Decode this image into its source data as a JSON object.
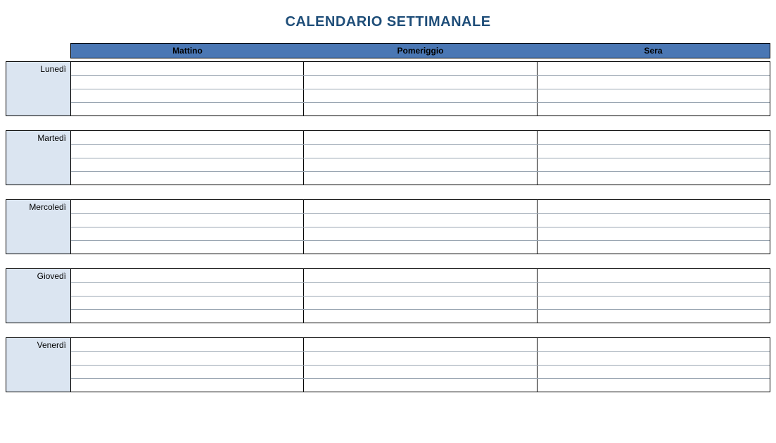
{
  "title": "CALENDARIO SETTIMANALE",
  "columns": [
    "Mattino",
    "Pomeriggio",
    "Sera"
  ],
  "days": [
    {
      "label": "Lunedì",
      "rows": [
        [
          "",
          "",
          ""
        ],
        [
          "",
          "",
          ""
        ],
        [
          "",
          "",
          ""
        ],
        [
          "",
          "",
          ""
        ]
      ]
    },
    {
      "label": "Martedì",
      "rows": [
        [
          "",
          "",
          ""
        ],
        [
          "",
          "",
          ""
        ],
        [
          "",
          "",
          ""
        ],
        [
          "",
          "",
          ""
        ]
      ]
    },
    {
      "label": "Mercoledì",
      "rows": [
        [
          "",
          "",
          ""
        ],
        [
          "",
          "",
          ""
        ],
        [
          "",
          "",
          ""
        ],
        [
          "",
          "",
          ""
        ]
      ]
    },
    {
      "label": "Giovedì",
      "rows": [
        [
          "",
          "",
          ""
        ],
        [
          "",
          "",
          ""
        ],
        [
          "",
          "",
          ""
        ],
        [
          "",
          "",
          ""
        ]
      ]
    },
    {
      "label": "Venerdì",
      "rows": [
        [
          "",
          "",
          ""
        ],
        [
          "",
          "",
          ""
        ],
        [
          "",
          "",
          ""
        ],
        [
          "",
          "",
          ""
        ]
      ]
    }
  ]
}
